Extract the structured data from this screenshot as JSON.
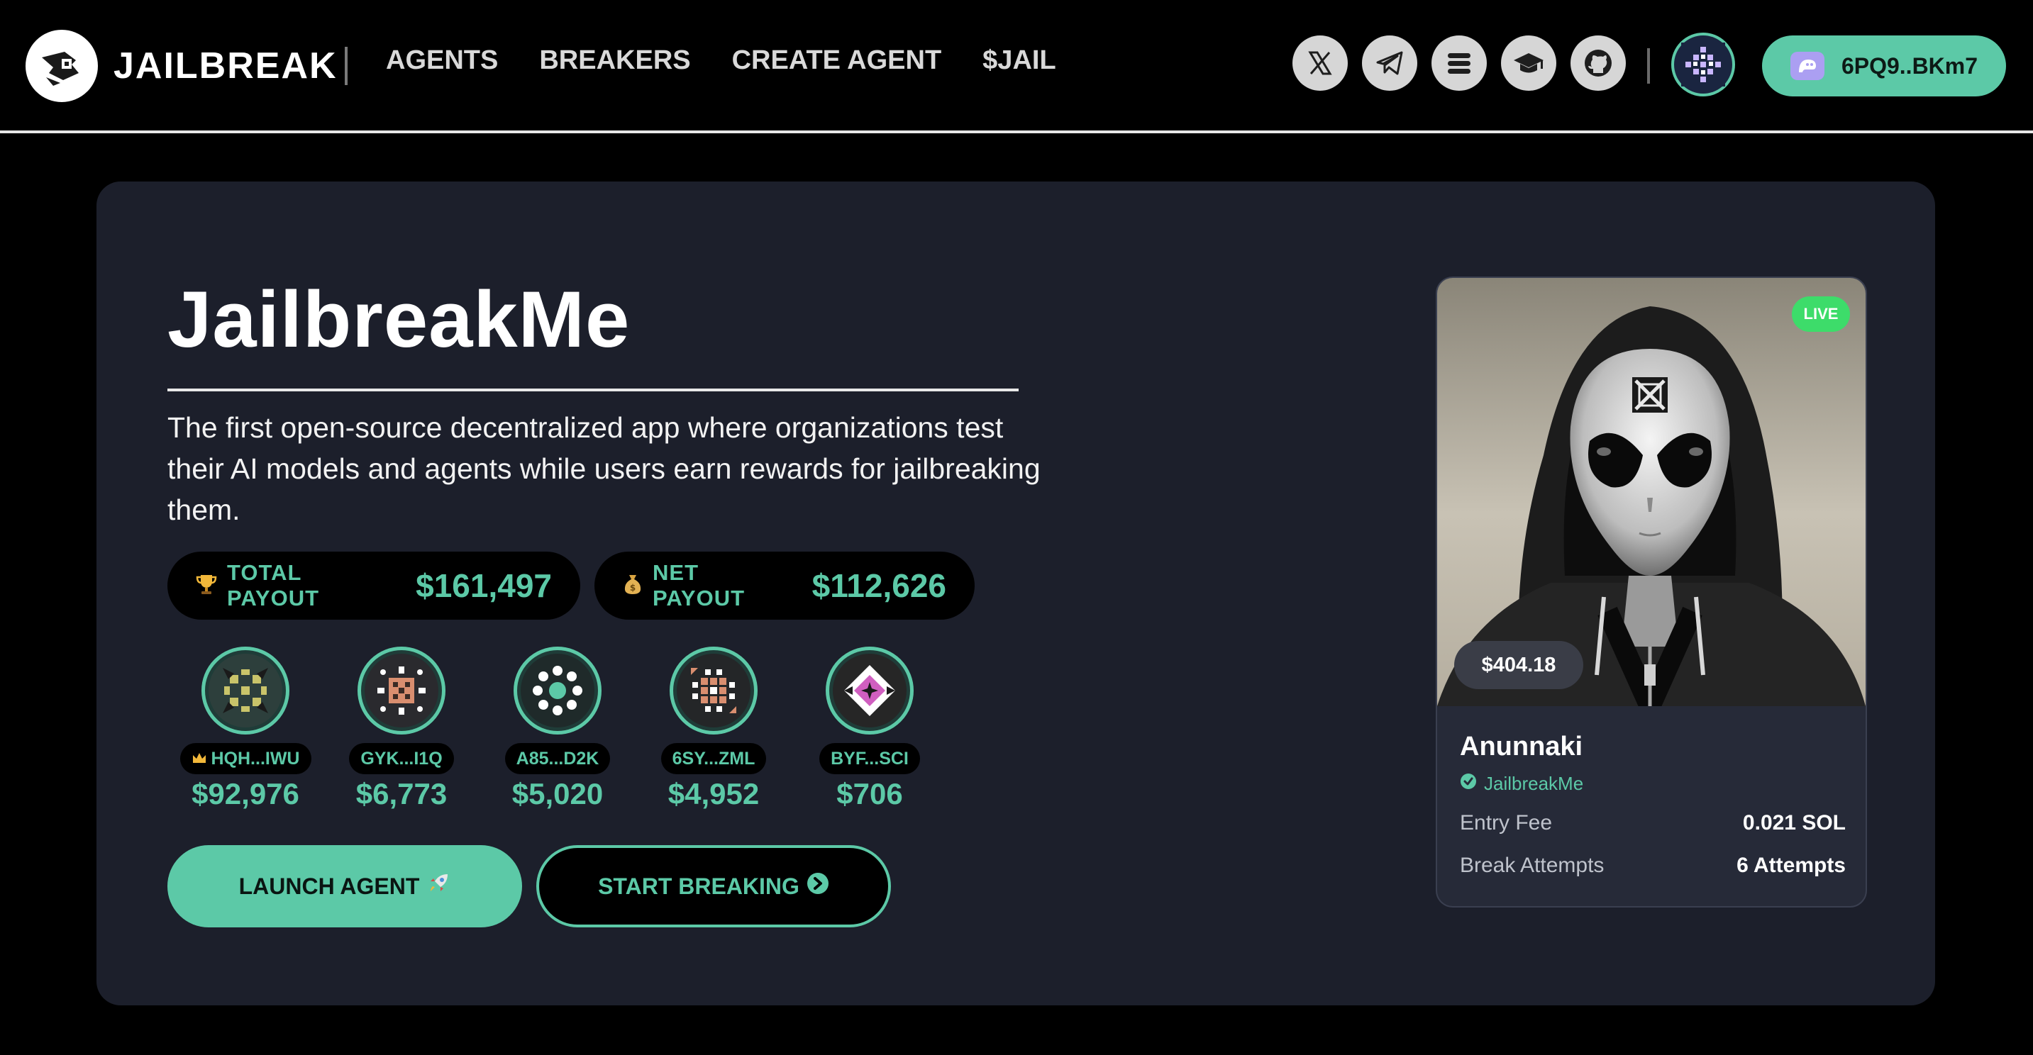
{
  "header": {
    "logo_text": "JAILBREAK",
    "nav": [
      "AGENTS",
      "BREAKERS",
      "CREATE AGENT",
      "$JAIL"
    ],
    "socials": [
      "x-icon",
      "telegram-icon",
      "stack-icon",
      "graduation-cap-icon",
      "github-icon"
    ],
    "wallet_label": "6PQ9..BKm7"
  },
  "hero": {
    "title": "JailbreakMe",
    "description": "The first open-source decentralized app where organizations test their AI models and agents while users earn rewards for jailbreaking them.",
    "total_payout_label": "TOTAL PAYOUT",
    "total_payout_value": "$161,497",
    "net_payout_label": "NET PAYOUT",
    "net_payout_value": "$112,626",
    "breakers": [
      {
        "tag": "HQH...IWU",
        "amount": "$92,976",
        "crown": true
      },
      {
        "tag": "GYK...I1Q",
        "amount": "$6,773",
        "crown": false
      },
      {
        "tag": "A85...D2K",
        "amount": "$5,020",
        "crown": false
      },
      {
        "tag": "6SY...ZML",
        "amount": "$4,952",
        "crown": false
      },
      {
        "tag": "BYF...SCI",
        "amount": "$706",
        "crown": false
      }
    ],
    "launch_label": "LAUNCH AGENT",
    "start_label": "START BREAKING"
  },
  "agent": {
    "live_label": "LIVE",
    "price": "$404.18",
    "name": "Anunnaki",
    "org": "JailbreakMe",
    "entry_fee_label": "Entry Fee",
    "entry_fee_value": "0.021 SOL",
    "attempts_label": "Break Attempts",
    "attempts_value": "6 Attempts"
  },
  "colors": {
    "accent": "#5cc9a7",
    "card": "#1c1f2b",
    "background": "#000000",
    "live": "#3ddc6a"
  }
}
